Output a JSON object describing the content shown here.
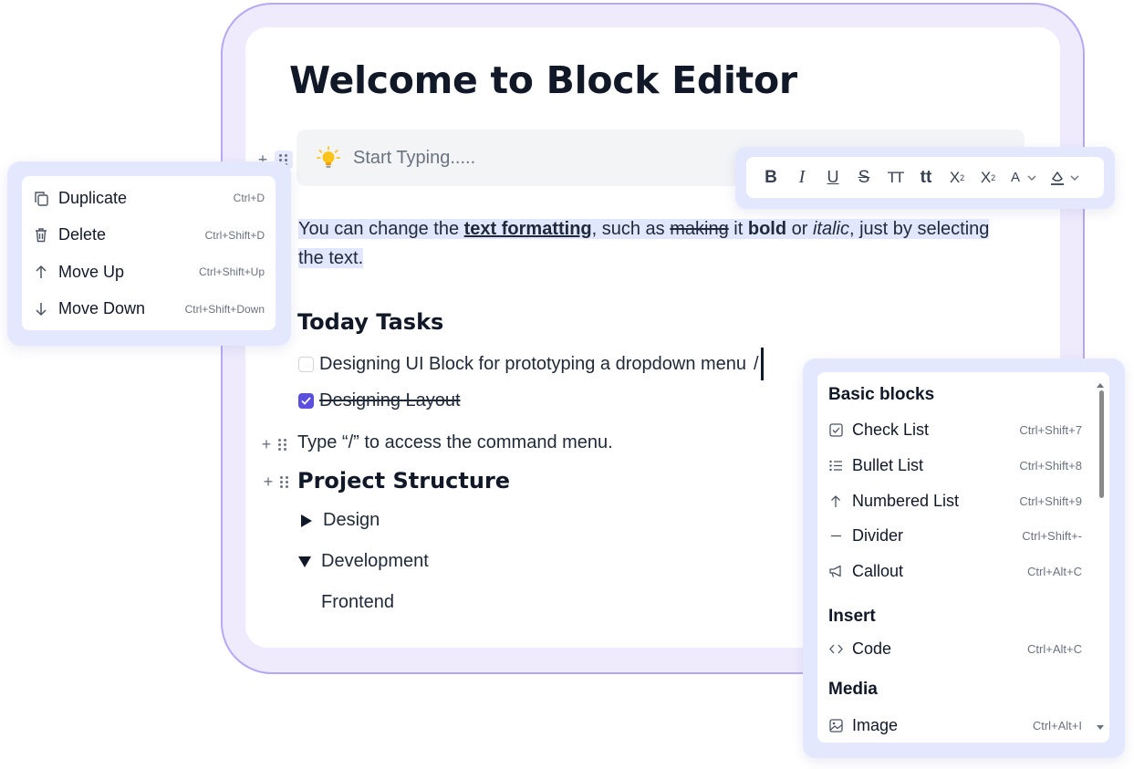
{
  "editor": {
    "title": "Welcome to Block Editor",
    "placeholder": "Start Typing.....",
    "paragraph": {
      "part1": "You can change the ",
      "bold_underline": "text formatting",
      "part2": ", such as ",
      "strike": "making",
      "part3": " it ",
      "bold": "bold",
      "part4": " or ",
      "italic": "italic",
      "part5": ", just by selecting the text."
    },
    "heading_tasks": "Today Tasks",
    "tasks": [
      {
        "label": "Designing UI Block for prototyping a dropdown menu",
        "checked": false
      },
      {
        "label": "Designing Layout",
        "checked": true
      }
    ],
    "slash": "/",
    "command_hint": "Type “/” to access the command menu.",
    "heading_structure": "Project Structure",
    "toggles": [
      {
        "label": "Design",
        "expanded": false
      },
      {
        "label": "Development",
        "expanded": true
      }
    ],
    "nested": "Frontend"
  },
  "toolbar": {
    "buttons": [
      "bold",
      "italic",
      "underline",
      "strikethrough",
      "uppercase",
      "capitalize",
      "superscript",
      "subscript",
      "text-color",
      "highlight"
    ],
    "labels": {
      "bold": "B",
      "italic": "I",
      "underline": "U",
      "strikethrough": "S",
      "uppercase": "TT",
      "capitalize": "tt",
      "superscript": "X",
      "superscript_mark": "2",
      "subscript": "X",
      "subscript_mark": "2",
      "text_color": "A"
    }
  },
  "block_menu": {
    "items": [
      {
        "label": "Duplicate",
        "shortcut": "Ctrl+D",
        "icon": "copy-icon"
      },
      {
        "label": "Delete",
        "shortcut": "Ctrl+Shift+D",
        "icon": "trash-icon"
      },
      {
        "label": "Move Up",
        "shortcut": "Ctrl+Shift+Up",
        "icon": "arrow-up-icon"
      },
      {
        "label": "Move Down",
        "shortcut": "Ctrl+Shift+Down",
        "icon": "arrow-down-icon"
      }
    ]
  },
  "command_menu": {
    "sections": {
      "basic": "Basic blocks",
      "insert": "Insert",
      "media": "Media"
    },
    "basic_items": [
      {
        "label": "Check List",
        "shortcut": "Ctrl+Shift+7",
        "icon": "checkbox-icon"
      },
      {
        "label": "Bullet List",
        "shortcut": "Ctrl+Shift+8",
        "icon": "list-icon"
      },
      {
        "label": "Numbered List",
        "shortcut": "Ctrl+Shift+9",
        "icon": "arrow-up-icon"
      },
      {
        "label": "Divider",
        "shortcut": "Ctrl+Shift+-",
        "icon": "divider-icon"
      },
      {
        "label": "Callout",
        "shortcut": "Ctrl+Alt+C",
        "icon": "megaphone-icon"
      }
    ],
    "insert_items": [
      {
        "label": "Code",
        "shortcut": "Ctrl+Alt+C",
        "icon": "code-icon"
      }
    ],
    "media_items": [
      {
        "label": "Image",
        "shortcut": "Ctrl+Alt+I",
        "icon": "image-icon"
      }
    ]
  },
  "colors": {
    "accent": "#5b4fe0",
    "frame": "#efebfd",
    "frame_border": "#b7a8f4",
    "selection": "#e1e7ff",
    "menu_shell": "#e3e8ff"
  }
}
